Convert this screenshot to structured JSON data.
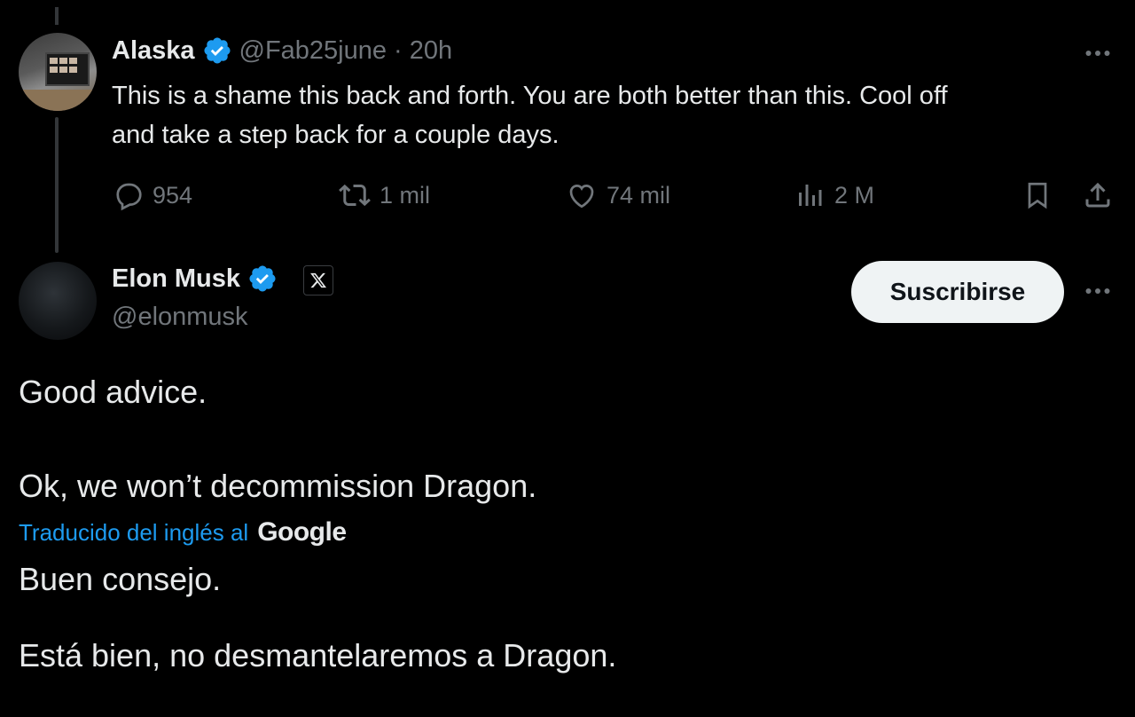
{
  "reply": {
    "author_name": "Alaska",
    "handle": "@Fab25june",
    "separator": "·",
    "time": "20h",
    "text_line1": "This is a shame this back and forth. You are both better than this. Cool off",
    "text_line2": "and take a step back for a couple days.",
    "actions": {
      "replies": "954",
      "reposts": "1 mil",
      "likes": "74 mil",
      "views": "2 M"
    }
  },
  "main": {
    "author_name": "Elon Musk",
    "handle": "@elonmusk",
    "subscribe_label": "Suscribirse",
    "original": {
      "line1": "Good advice.",
      "line2": "Ok, we won’t decommission Dragon."
    },
    "translation": {
      "label": "Traducido del inglés al",
      "provider": "Google",
      "line1": "Buen consejo.",
      "line2": "Está bien, no desmantelaremos a Dragon."
    }
  },
  "colors": {
    "background": "#000000",
    "text": "#e7e9ea",
    "muted": "#71767b",
    "accent": "#1d9bf0",
    "button_bg": "#eff3f4"
  },
  "icons": [
    "verified-badge-icon",
    "more-icon",
    "reply-icon",
    "repost-icon",
    "like-icon",
    "views-icon",
    "bookmark-icon",
    "share-icon",
    "x-logo-icon"
  ]
}
